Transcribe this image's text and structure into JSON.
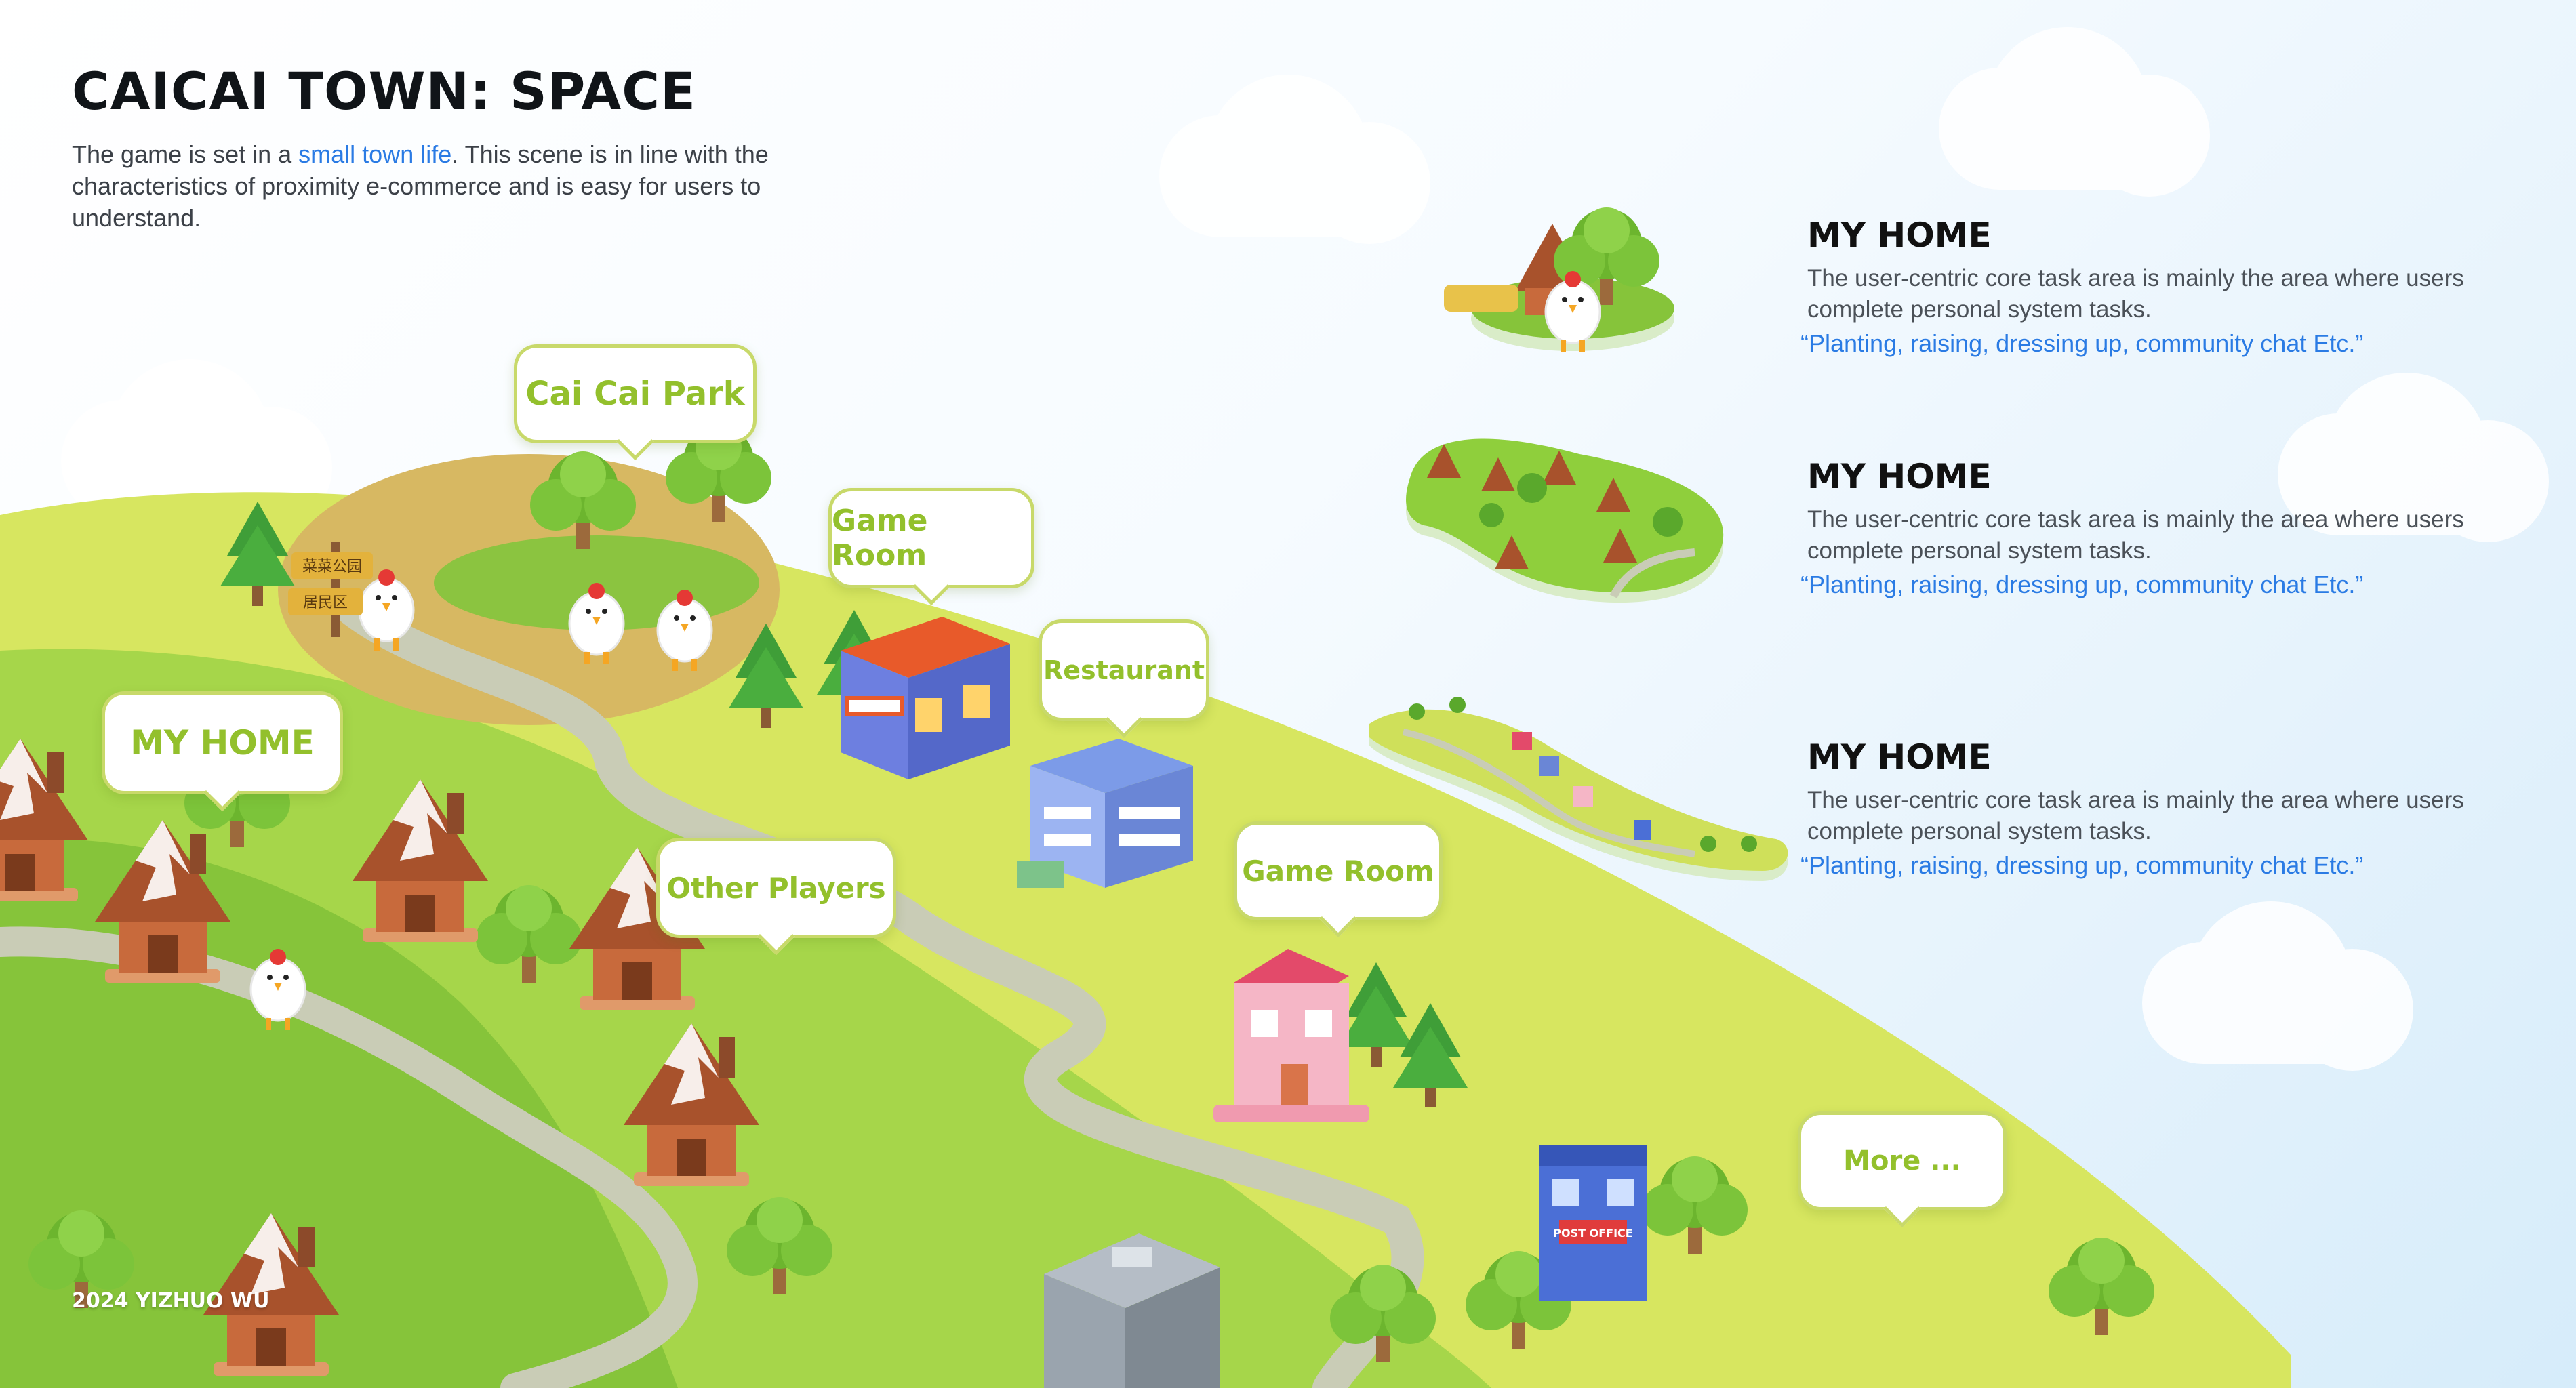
{
  "header": {
    "title": "CAICAI TOWN: SPACE",
    "intro_before": "The game is set in a ",
    "intro_highlight": "small town life",
    "intro_after": ". This scene is in line with the characteristics of proximity e-commerce and is easy for users to understand."
  },
  "map_labels": {
    "park": "Cai Cai Park",
    "game_room_1": "Game Room",
    "restaurant": "Restaurant",
    "my_home": "MY HOME",
    "other_players": "Other Players",
    "game_room_2": "Game Room",
    "more": "More ..."
  },
  "signpost": {
    "line1": "菜菜公园",
    "line2": "居民区"
  },
  "post_office_sign": "POST OFFICE",
  "info_cards": [
    {
      "title": "MY HOME",
      "description": "The user-centric core task area is mainly the area where users complete personal system tasks.",
      "quote": "“Planting, raising, dressing up, community chat Etc.”"
    },
    {
      "title": "MY HOME",
      "description": "The user-centric core task area is mainly the area where users complete personal system tasks.",
      "quote": "“Planting, raising, dressing up, community chat Etc.”"
    },
    {
      "title": "MY HOME",
      "description": "The user-centric core task area is mainly the area where users complete personal system tasks.",
      "quote": "“Planting, raising, dressing up, community chat Etc.”"
    }
  ],
  "footer": {
    "credit": "2024 YIZHUO WU"
  },
  "colors": {
    "accent_blue": "#2a7be4",
    "label_green": "#93c02c",
    "bubble_border": "#c8d96a",
    "hill_light": "#dce968",
    "hill_dark": "#8fcf3c",
    "road": "#c9ccb6"
  }
}
